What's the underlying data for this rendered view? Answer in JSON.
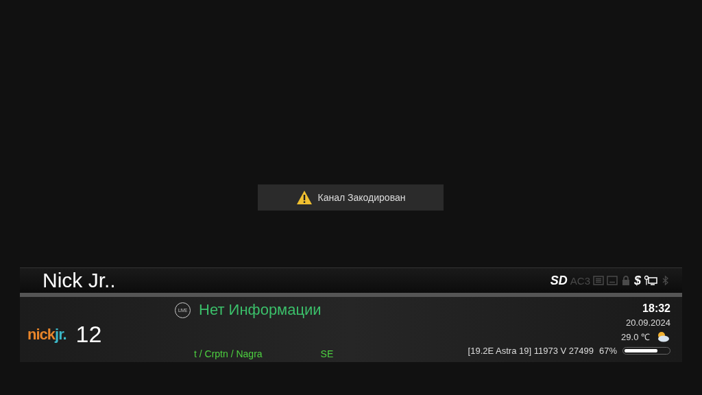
{
  "toast": {
    "message": "Канал Закодирован"
  },
  "channel": {
    "name": "Nick Jr..",
    "number": "12",
    "logo": [
      "nick",
      "jr."
    ]
  },
  "indicators": [
    {
      "kind": "text",
      "text": "SD",
      "on": true
    },
    {
      "kind": "text",
      "text": "AC3",
      "on": false
    },
    {
      "kind": "teletext",
      "on": false
    },
    {
      "kind": "subtitles",
      "on": false
    },
    {
      "kind": "lock",
      "on": false
    },
    {
      "kind": "text",
      "text": "$",
      "on": true
    },
    {
      "kind": "network",
      "on": true
    },
    {
      "kind": "bluetooth",
      "on": false
    }
  ],
  "program": {
    "badge": "LIVE",
    "title": "Нет Информации",
    "crypt_info": "t / Crptn / Nagra",
    "column_2": "SE"
  },
  "clock": {
    "time": "18:32",
    "date": "20.09.2024"
  },
  "weather": {
    "temperature": "29.0 ℃"
  },
  "signal": {
    "transponder": "[19.2E Astra 19] 11973 V 27499",
    "quality": "67%",
    "level": 0.75
  }
}
